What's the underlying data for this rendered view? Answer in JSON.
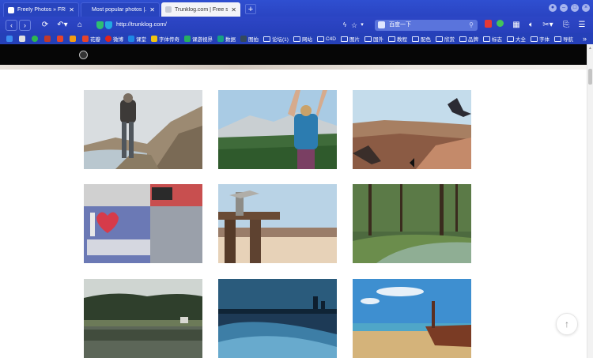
{
  "tabs": [
    {
      "title": "Freely Photos » FREE C...",
      "close": "✕"
    },
    {
      "title": "Most popular photos |...",
      "close": "✕"
    },
    {
      "title": "Trunklog.com | Free sto...",
      "close": "✕"
    }
  ],
  "new_tab": "+",
  "toolbar": {
    "url": "http://trunklog.com/",
    "search_placeholder": "百度一下"
  },
  "bookmarks": [
    {
      "label": "",
      "color": "#3b8cf0"
    },
    {
      "label": "",
      "color": "#e0e0e0"
    },
    {
      "label": "",
      "color": "#2db84d"
    },
    {
      "label": "",
      "color": "#c0392b"
    },
    {
      "label": "",
      "color": "#e7442b"
    },
    {
      "label": "",
      "color": "#f39c12"
    },
    {
      "label": "花瓣",
      "color": "#e7442b"
    },
    {
      "label": "微博",
      "color": "#e2231a"
    },
    {
      "label": "课堂",
      "color": "#1e88e5"
    },
    {
      "label": "字体传奇",
      "color": "#f1c40f"
    },
    {
      "label": "课游视界",
      "color": "#27ae60"
    },
    {
      "label": "数据",
      "color": "#16a085"
    },
    {
      "label": "图拍",
      "color": "#34495e"
    }
  ],
  "bookmark_folders": [
    "论坛(1)",
    "网站",
    "C4D",
    "图片",
    "国外",
    "教程",
    "配色",
    "欣赏",
    "品牌",
    "标志",
    "大全",
    "字体",
    "导航"
  ],
  "bookmarks_more": "»",
  "page": {
    "back_to_top": "↑"
  }
}
